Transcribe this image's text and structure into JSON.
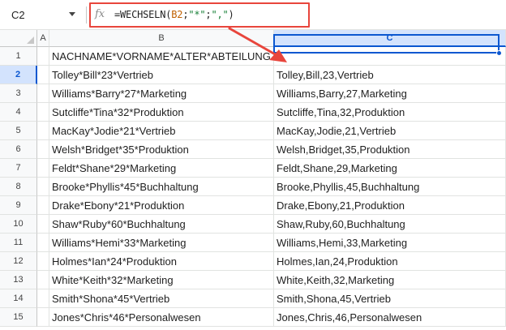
{
  "formula_bar": {
    "name_box": "C2",
    "fx_icon": "function-icon",
    "formula_prefix": "=WECHSELN(",
    "formula_ref": "B2",
    "formula_sep1": ";",
    "formula_arg1": "\"*\"",
    "formula_sep2": ";",
    "formula_arg2": "\",\"",
    "formula_suffix": ")"
  },
  "columns": [
    "A",
    "B",
    "C"
  ],
  "selected_column": "C",
  "selected_row": "2",
  "rows": [
    {
      "num": "1",
      "b": "NACHNAME*VORNAME*ALTER*ABTEILUNG",
      "c": ""
    },
    {
      "num": "2",
      "b": "Tolley*Bill*23*Vertrieb",
      "c": "Tolley,Bill,23,Vertrieb"
    },
    {
      "num": "3",
      "b": "Williams*Barry*27*Marketing",
      "c": "Williams,Barry,27,Marketing"
    },
    {
      "num": "4",
      "b": "Sutcliffe*Tina*32*Produktion",
      "c": "Sutcliffe,Tina,32,Produktion"
    },
    {
      "num": "5",
      "b": "MacKay*Jodie*21*Vertrieb",
      "c": "MacKay,Jodie,21,Vertrieb"
    },
    {
      "num": "6",
      "b": "Welsh*Bridget*35*Produktion",
      "c": "Welsh,Bridget,35,Produktion"
    },
    {
      "num": "7",
      "b": "Feldt*Shane*29*Marketing",
      "c": "Feldt,Shane,29,Marketing"
    },
    {
      "num": "8",
      "b": "Brooke*Phyllis*45*Buchhaltung",
      "c": "Brooke,Phyllis,45,Buchhaltung"
    },
    {
      "num": "9",
      "b": "Drake*Ebony*21*Produktion",
      "c": "Drake,Ebony,21,Produktion"
    },
    {
      "num": "10",
      "b": "Shaw*Ruby*60*Buchhaltung",
      "c": "Shaw,Ruby,60,Buchhaltung"
    },
    {
      "num": "11",
      "b": "Williams*Hemi*33*Marketing",
      "c": "Williams,Hemi,33,Marketing"
    },
    {
      "num": "12",
      "b": "Holmes*Ian*24*Produktion",
      "c": "Holmes,Ian,24,Produktion"
    },
    {
      "num": "13",
      "b": "White*Keith*32*Marketing",
      "c": "White,Keith,32,Marketing"
    },
    {
      "num": "14",
      "b": "Smith*Shona*45*Vertrieb",
      "c": "Smith,Shona,45,Vertrieb"
    },
    {
      "num": "15",
      "b": "Jones*Chris*46*Personalwesen",
      "c": "Jones,Chris,46,Personalwesen"
    }
  ],
  "colors": {
    "highlight_box": "#e8453c",
    "selection": "#0b57d0",
    "header_selected_bg": "#d3e3fd"
  }
}
